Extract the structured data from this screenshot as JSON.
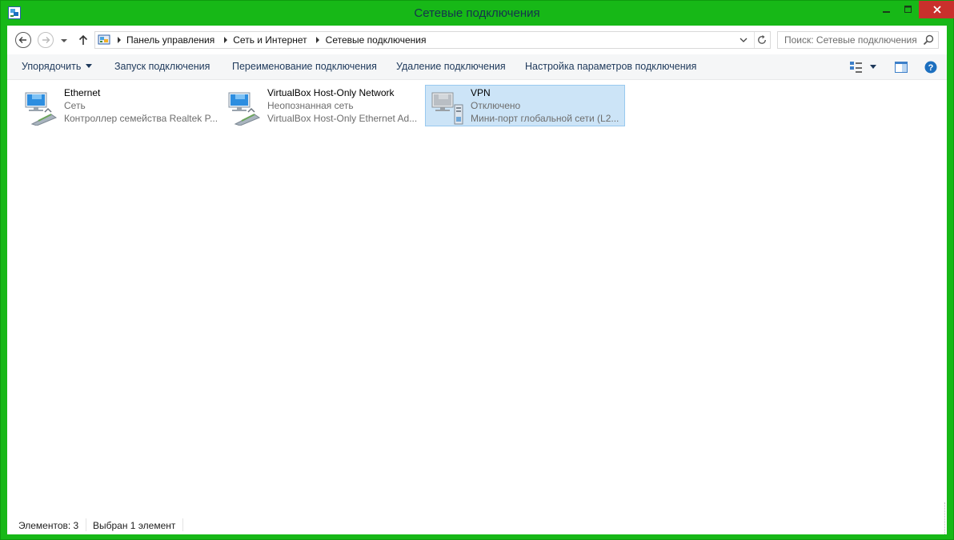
{
  "window": {
    "title": "Сетевые подключения",
    "frame_color": "#17b817",
    "close_color": "#c9302c"
  },
  "address": {
    "crumbs": [
      "Панель управления",
      "Сеть и Интернет",
      "Сетевые подключения"
    ]
  },
  "search": {
    "placeholder": "Поиск: Сетевые подключения"
  },
  "toolbar": {
    "organize": "Упорядочить",
    "start_connection": "Запуск подключения",
    "rename_connection": "Переименование подключения",
    "delete_connection": "Удаление подключения",
    "connection_settings": "Настройка параметров подключения"
  },
  "connections": [
    {
      "name": "Ethernet",
      "status": "Сеть",
      "device": "Контроллер семейства Realtek P...",
      "icon": "network-adapter-icon"
    },
    {
      "name": "VirtualBox Host-Only Network",
      "status": "Неопознанная сеть",
      "device": "VirtualBox Host-Only Ethernet Ad...",
      "icon": "network-adapter-icon"
    },
    {
      "name": "VPN",
      "status": "Отключено",
      "device": "Мини-порт глобальной сети (L2...",
      "icon": "vpn-disconnected-icon",
      "selected": true
    }
  ],
  "status": {
    "count": "Элементов: 3",
    "selected": "Выбран 1 элемент"
  },
  "colors": {
    "selection_bg": "#cce4f7",
    "selection_border": "#99c9ef",
    "command_text": "#1e395b"
  }
}
